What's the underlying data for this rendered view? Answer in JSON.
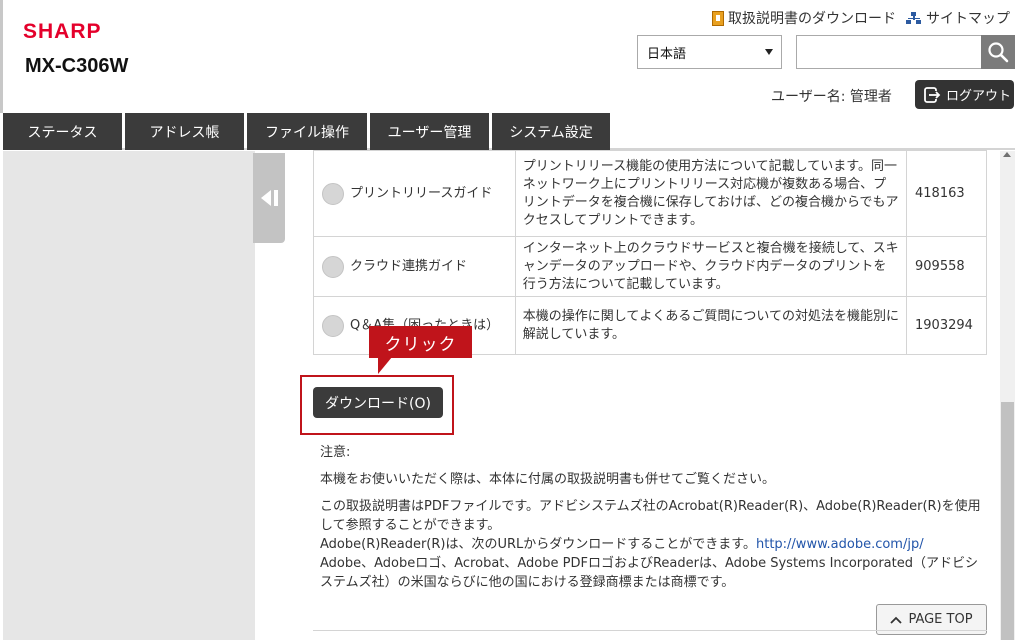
{
  "header": {
    "brand": "SHARP",
    "model": "MX-C306W",
    "links": [
      {
        "label": "取扱説明書のダウンロード"
      },
      {
        "label": "サイトマップ"
      }
    ],
    "language": "日本語",
    "search_placeholder": "",
    "user_label": "ユーザー名: 管理者",
    "logout_label": "ログアウト"
  },
  "tabs": [
    {
      "label": "ステータス"
    },
    {
      "label": "アドレス帳"
    },
    {
      "label": "ファイル操作"
    },
    {
      "label": "ユーザー管理"
    },
    {
      "label": "システム設定"
    }
  ],
  "manuals": [
    {
      "name": "プリントリリースガイド",
      "description": "プリントリリース機能の使用方法について記載しています。同一ネットワーク上にプリントリリース対応機が複数ある場合、プリントデータを複合機に保存しておけば、どの複合機からでもアクセスしてプリントできます。",
      "size": "418163"
    },
    {
      "name": "クラウド連携ガイド",
      "description": "インターネット上のクラウドサービスと複合機を接続して、スキャンデータのアップロードや、クラウド内データのプリントを行う方法について記載しています。",
      "size": "909558"
    },
    {
      "name": "Q＆A集（困ったときは）",
      "description": "本機の操作に関してよくあるご質問についての対処法を機能別に解説しています。",
      "size": "1903294"
    }
  ],
  "callout_label": "クリック",
  "download_button": "ダウンロード(O)",
  "notice": {
    "heading": "注意:",
    "line1": "本機をお使いいただく際は、本体に付属の取扱説明書も併せてご覧ください。",
    "line2a": "この取扱説明書はPDFファイルです。アドビシステムズ社のAcrobat(R)Reader(R)、Adobe(R)Reader(R)を使用して参照することができます。",
    "line2b": "Adobe(R)Reader(R)は、次のURLからダウンロードすることができます。",
    "url": "http://www.adobe.com/jp/",
    "line2c": "Adobe、Adobeロゴ、Acrobat、Adobe PDFロゴおよびReaderは、Adobe Systems Incorporated（アドビシステムズ社）の米国ならびに他の国における登録商標または商標です。"
  },
  "page_top_label": "PAGE TOP",
  "colors": {
    "brand_red": "#e4002b",
    "highlight_red": "#c0141b",
    "tab_dark": "#3b3b3b",
    "link_blue": "#2255aa"
  }
}
